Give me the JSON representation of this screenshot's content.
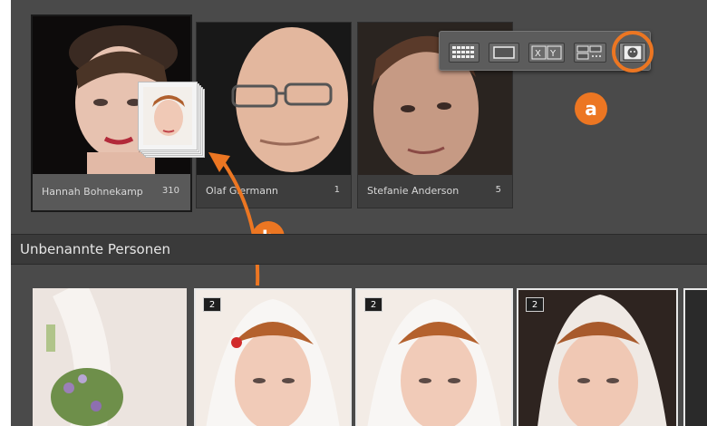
{
  "named_people": [
    {
      "name": "Hannah Bohnekamp",
      "count": "310"
    },
    {
      "name": "Olaf Giermann",
      "count": "1"
    },
    {
      "name": "Stefanie Anderson",
      "count": "5"
    }
  ],
  "toolbar": {
    "buttons": [
      "grid-view-icon",
      "loupe-view-icon",
      "compare-view-icon",
      "survey-view-icon",
      "people-view-icon"
    ],
    "compare_label": "X|Y"
  },
  "callouts": {
    "a": "a",
    "b": "b"
  },
  "unnamed_section": {
    "title": "Unbenannte Personen",
    "stacks": [
      "2",
      "2",
      "2"
    ]
  },
  "colors": {
    "accent": "#ec7622",
    "panel": "#4a4a4a",
    "header": "#3a3a3a"
  }
}
